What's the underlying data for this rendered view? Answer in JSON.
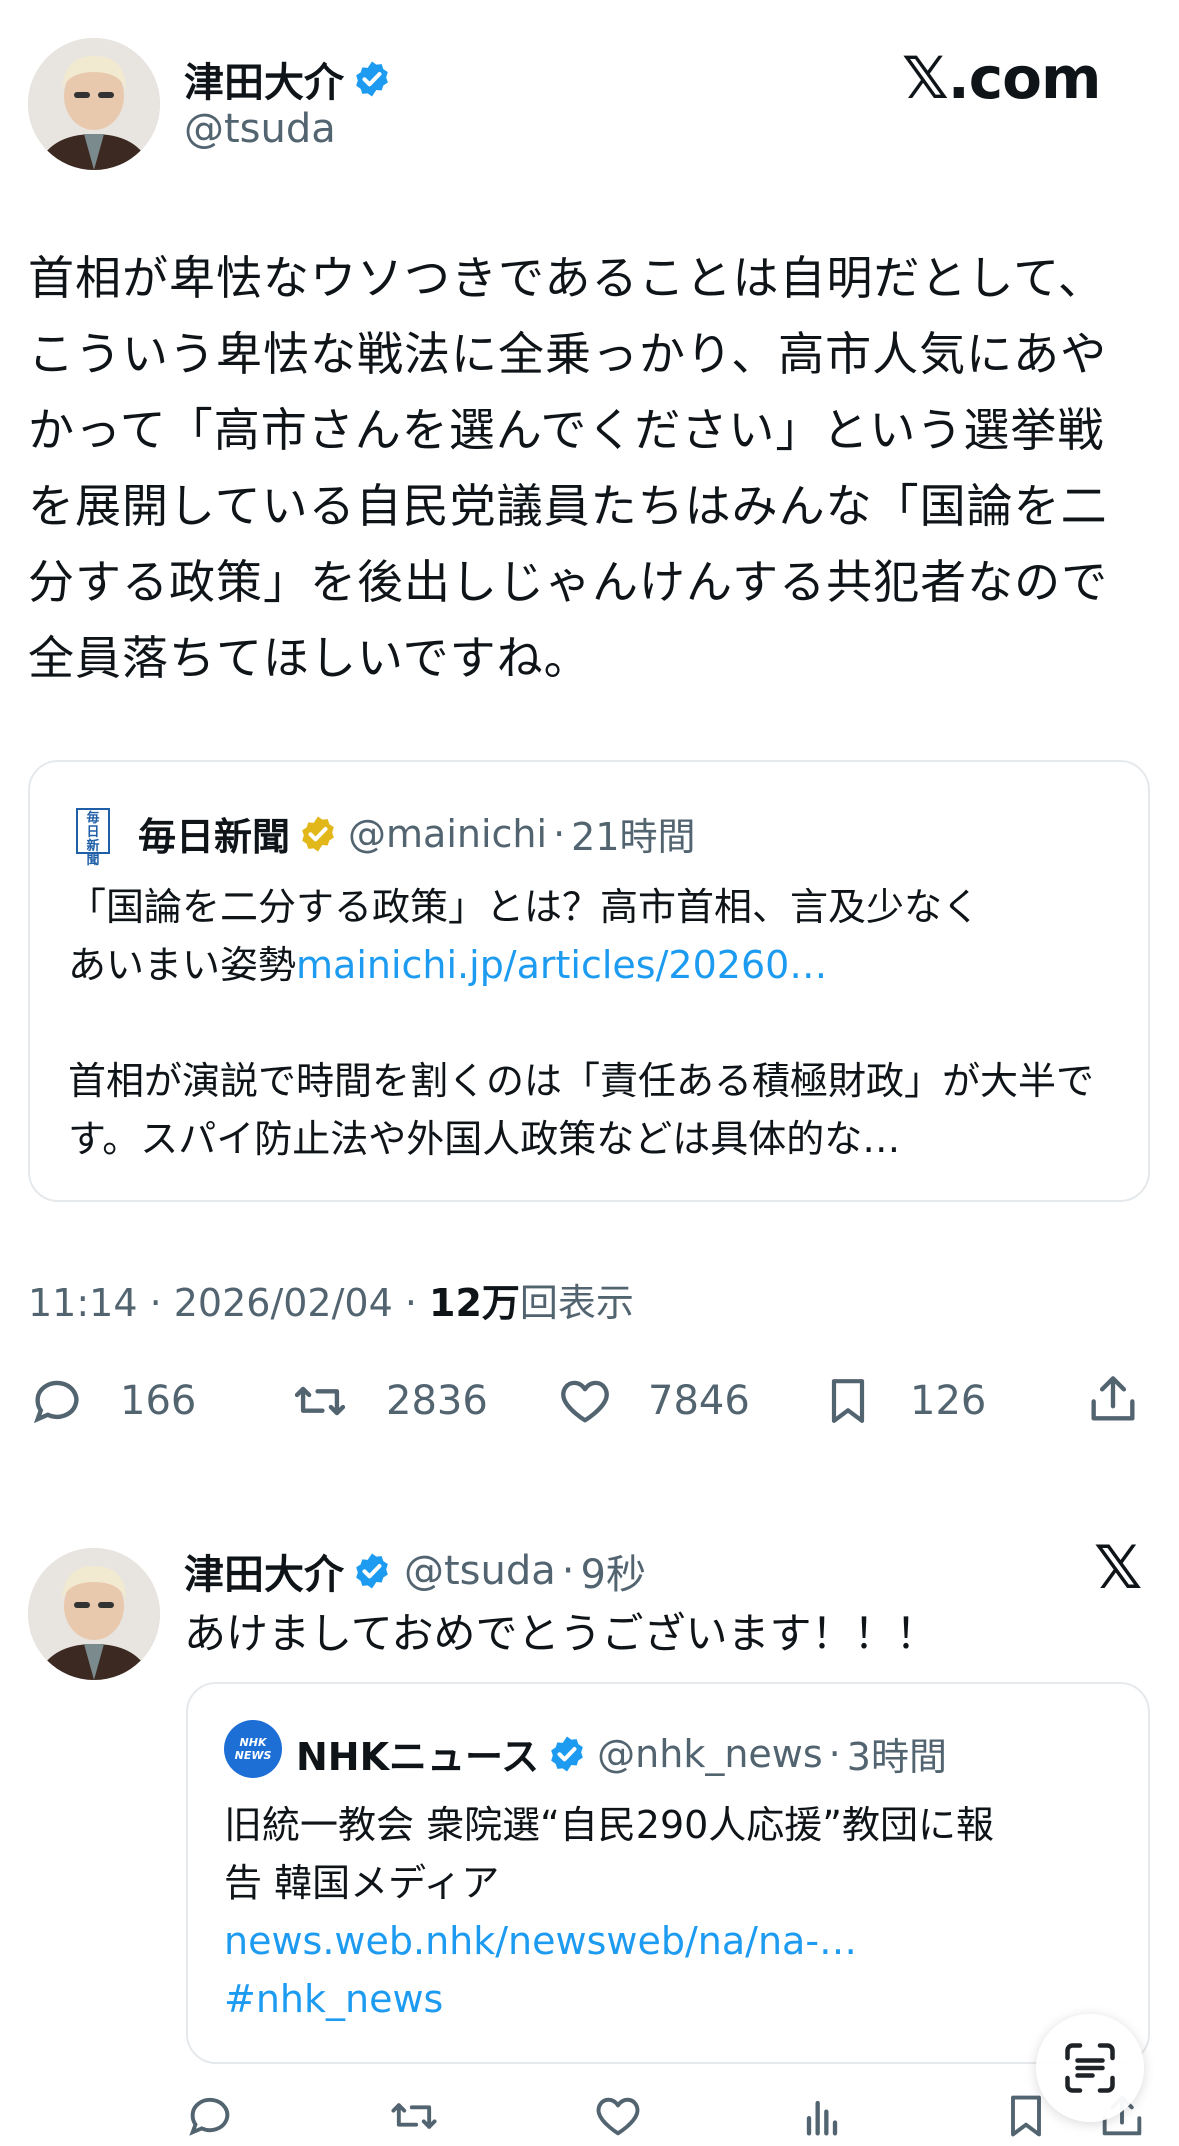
{
  "header": {
    "author_name": "津田大介",
    "author_handle": "@tsuda",
    "site_logo": "𝕏.com"
  },
  "post": {
    "text": "首相が卑怯なウソつきであることは自明だとして、こういう卑怯な戦法に全乗っかり、高市人気にあやかって「高市さんを選んでください」という選挙戦を展開している自民党議員たちはみんな「国論を二分する政策」を後出しじゃんけんする共犯者なので全員落ちてほしいですね。",
    "quote": {
      "logo_text": "毎日新聞",
      "name": "毎日新聞",
      "handle": "@mainichi",
      "time": "21時間",
      "text_line1": "「国論を二分する政策」とは？高市首相、言及少なく",
      "text_line2_plain": "あいまい姿勢",
      "text_line2_link": "mainichi.jp/articles/20260…",
      "text_para2": "首相が演説で時間を割くのは「責任ある積極財政」が大半です。スパイ防止法や外国人政策などは具体的な…"
    },
    "meta": {
      "time_date": "11:14 · 2026/02/04 · ",
      "views_count": "12万",
      "views_label": "回表示"
    },
    "actions": {
      "replies": "166",
      "reposts": "2836",
      "likes": "7846",
      "bookmarks": "126"
    }
  },
  "second_post": {
    "author_name": "津田大介",
    "handle": "@tsuda",
    "time": "9秒",
    "text": "あけましておめでとうございます！！！",
    "quote": {
      "name": "NHKニュース",
      "handle": "@nhk_news",
      "time": "3時間",
      "logo_text": "NHK NEWS",
      "text_line1": "旧統一教会 衆院選“自民290人応援”教団に報",
      "text_line2": "告 韓国メディア",
      "link": "news.web.nhk/newsweb/na/na-…",
      "hashtag": "#nhk_news"
    }
  },
  "icons": {
    "verified_blue": "#1d9bf0",
    "verified_gold": "#e2b719",
    "x_logo": "x-logo-icon",
    "scan_button": "text-scan-icon"
  }
}
